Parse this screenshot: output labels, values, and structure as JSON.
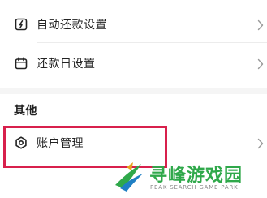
{
  "settings": {
    "items": [
      {
        "label": "自动还款设置",
        "icon": "auto-repay-icon"
      },
      {
        "label": "还款日设置",
        "icon": "calendar-icon"
      }
    ]
  },
  "other_section": {
    "title": "其他",
    "items": [
      {
        "label": "账户管理",
        "icon": "account-settings-icon"
      }
    ]
  },
  "highlight": {
    "color": "#d8204c"
  },
  "watermark": {
    "title": "寻峰游戏园",
    "subtitle": "PEAK SEARCH GAME PARK",
    "color": "#2fa84a"
  }
}
